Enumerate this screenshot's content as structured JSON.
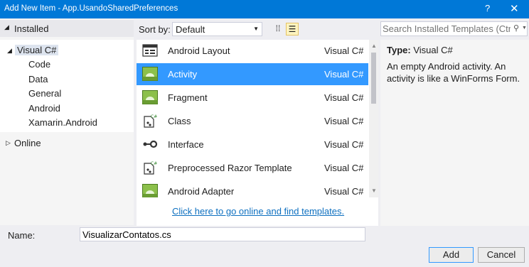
{
  "window": {
    "title": "Add New Item - App.UsandoSharedPreferences",
    "help": "?",
    "close": "✕"
  },
  "left": {
    "header": "Installed",
    "tree": [
      {
        "label": "Visual C#",
        "selected": true
      },
      {
        "label": "Code"
      },
      {
        "label": "Data"
      },
      {
        "label": "General"
      },
      {
        "label": "Android"
      },
      {
        "label": "Xamarin.Android"
      }
    ],
    "online": "Online"
  },
  "sort": {
    "label": "Sort by:",
    "value": "Default"
  },
  "templates": [
    {
      "name": "Android Layout",
      "lang": "Visual C#",
      "icon": "android-layout-icon",
      "selected": false
    },
    {
      "name": "Activity",
      "lang": "Visual C#",
      "icon": "activity-icon",
      "selected": true
    },
    {
      "name": "Fragment",
      "lang": "Visual C#",
      "icon": "fragment-icon",
      "selected": false
    },
    {
      "name": "Class",
      "lang": "Visual C#",
      "icon": "class-icon",
      "selected": false
    },
    {
      "name": "Interface",
      "lang": "Visual C#",
      "icon": "interface-icon",
      "selected": false
    },
    {
      "name": "Preprocessed Razor Template",
      "lang": "Visual C#",
      "icon": "razor-template-icon",
      "selected": false
    },
    {
      "name": "Android Adapter",
      "lang": "Visual C#",
      "icon": "android-adapter-icon",
      "selected": false
    }
  ],
  "online_link": "Click here to go online and find templates.",
  "search": {
    "placeholder": "Search Installed Templates (Ctrl"
  },
  "details": {
    "type_label": "Type:",
    "type_value": "Visual C#",
    "description": "An empty Android activity.  An activity is like a WinForms Form."
  },
  "bottom": {
    "name_label": "Name:",
    "name_value": "VisualizarContatos.cs",
    "add": "Add",
    "cancel": "Cancel"
  },
  "colors": {
    "titlebar": "#0078d7",
    "selection": "#3399ff",
    "link": "#0e70c0"
  }
}
